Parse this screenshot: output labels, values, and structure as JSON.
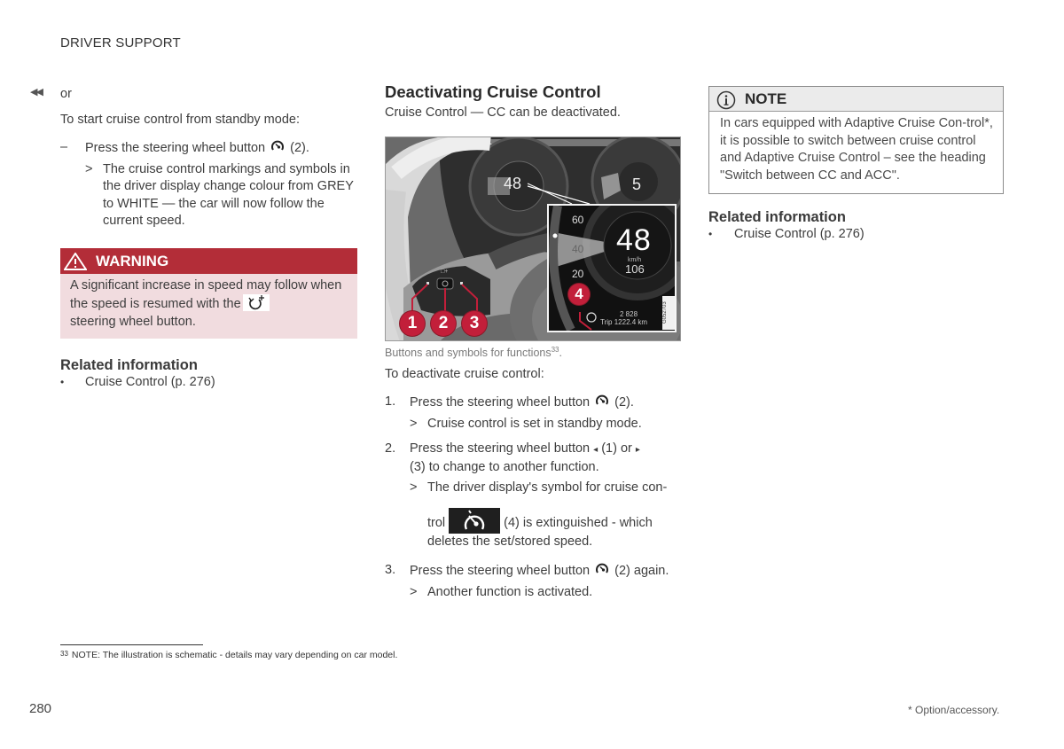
{
  "header": {
    "section_title": "DRIVER SUPPORT"
  },
  "left_column": {
    "continued_icon": "double-left-arrow-icon",
    "or_text": "or",
    "intro": "To start cruise control from standby mode:",
    "step": {
      "marker": "–",
      "text_before_icon": "Press the steering wheel button",
      "icon": "cruise-control-icon",
      "text_after_icon": "(2).",
      "result_marker": ">",
      "result": "The cruise control markings and symbols in the driver display change colour from GREY to WHITE — the car will now follow the current speed."
    },
    "warning": {
      "icon": "warning-triangle-icon",
      "title": "WARNING",
      "text_before_icon": "A significant increase in speed may follow when the speed is resumed with the",
      "icon_inline": "resume-speed-icon",
      "text_after_icon": "steering wheel button."
    },
    "related": {
      "title": "Related information",
      "items": [
        {
          "bullet": "•",
          "label": "Cruise Control (p. 276)"
        }
      ]
    }
  },
  "middle_column": {
    "title": "Deactivating Cruise Control",
    "subtitle": "Cruise Control — CC can be deactivated.",
    "figure": {
      "main_speed": "48",
      "tach_gear": "5",
      "inset_speed": "48",
      "inset_unit": "km/h",
      "inset_sub": "106",
      "inset_scale": [
        "60",
        "40",
        "20"
      ],
      "odometer": "2 828",
      "trip_label": "Trip",
      "trip_value": "1222.4",
      "trip_unit": "km",
      "image_code": "G052703",
      "callouts": [
        "1",
        "2",
        "3",
        "4"
      ],
      "accent_color": "#c21f3a"
    },
    "caption": "Buttons and symbols for functions",
    "caption_footnote_ref": "33",
    "caption_end": ".",
    "intro": "To deactivate cruise control:",
    "steps": [
      {
        "number": "1.",
        "text_before_icon": "Press the steering wheel button",
        "icon": "cruise-control-icon",
        "text_after_icon": "(2).",
        "result_marker": ">",
        "result": "Cruise control is set in standby mode."
      },
      {
        "number": "2.",
        "text_a": "Press the steering wheel button",
        "arrow_left": "◂",
        "text_b": "(1) or",
        "arrow_right": "▸",
        "text_c": "(3) to change to another function.",
        "result_marker": ">",
        "result_line1": "The driver display's symbol for cruise con-",
        "result_word": "trol",
        "result_icon": "cruise-control-display-icon",
        "result_after": "(4) is extinguished - which deletes the set/stored speed."
      },
      {
        "number": "3.",
        "text_before_icon": "Press the steering wheel button",
        "icon": "cruise-control-icon",
        "text_after_icon": "(2) again.",
        "result_marker": ">",
        "result": "Another function is activated."
      }
    ]
  },
  "right_column": {
    "note": {
      "icon": "info-icon",
      "title": "NOTE",
      "text": "In cars equipped with Adaptive Cruise Con-trol*, it is possible to switch between cruise control and Adaptive Cruise Control – see the heading \"Switch between CC and ACC\"."
    },
    "related": {
      "title": "Related information",
      "items": [
        {
          "bullet": "•",
          "label": "Cruise Control (p. 276)"
        }
      ]
    }
  },
  "footer": {
    "footnote_number": "33",
    "footnote_text": "NOTE: The illustration is schematic - details may vary depending on car model.",
    "page_number": "280",
    "option_note": "* Option/accessory."
  }
}
